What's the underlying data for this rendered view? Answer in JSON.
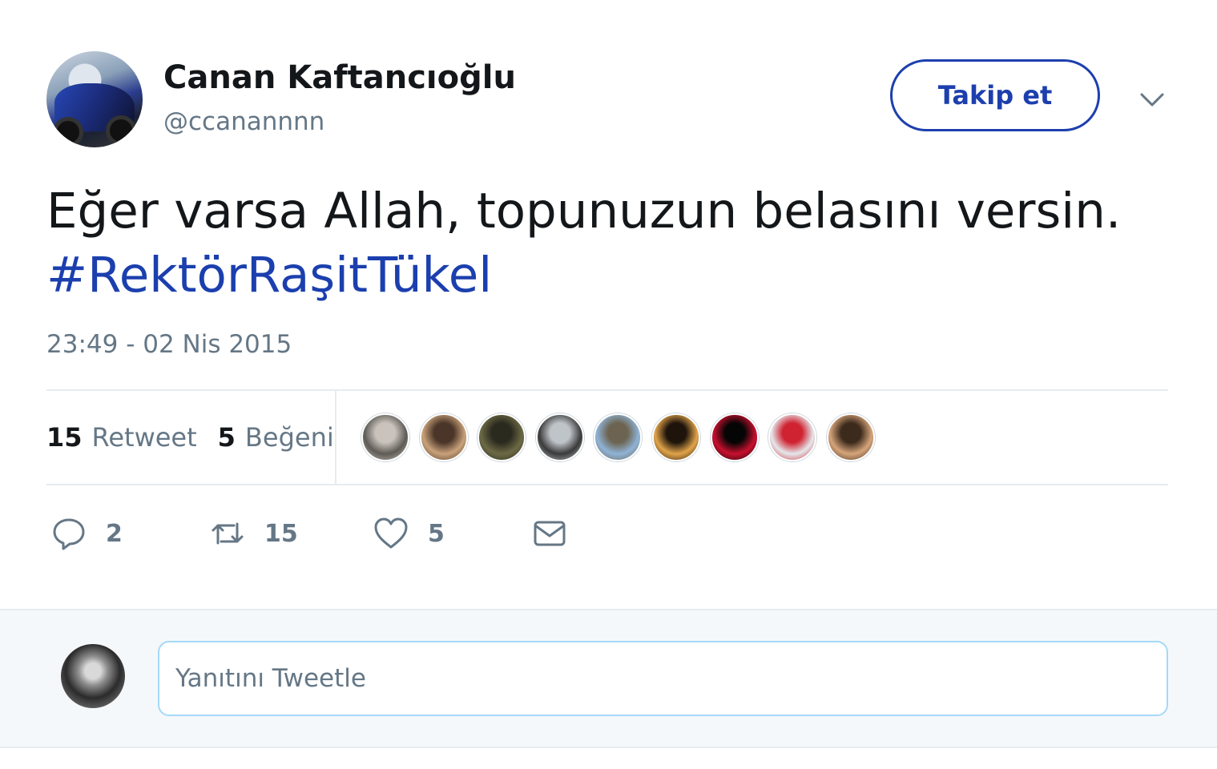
{
  "author": {
    "name": "Canan Kaftancıoğlu",
    "handle": "@ccanannnn"
  },
  "follow_label": "Takip et",
  "tweet": {
    "text": "Eğer varsa Allah, topunuzun belasını versin.",
    "hashtag": "#RektörRaşitTükel",
    "timestamp": "23:49 - 02 Nis 2015"
  },
  "stats": {
    "retweet_count": "15",
    "retweet_label": "Retweet",
    "like_count": "5",
    "like_label": "Beğeni"
  },
  "likers": [
    {
      "color_a": "#5e5a55",
      "color_b": "#c9c3bc"
    },
    {
      "color_a": "#c9a27a",
      "color_b": "#4a3528"
    },
    {
      "color_a": "#6c6a45",
      "color_b": "#2b2a1f"
    },
    {
      "color_a": "#3a3a3a",
      "color_b": "#bfc4c9"
    },
    {
      "color_a": "#8fb3d6",
      "color_b": "#6c6450"
    },
    {
      "color_a": "#e1a44a",
      "color_b": "#1e140b"
    },
    {
      "color_a": "#c8102e",
      "color_b": "#050505"
    },
    {
      "color_a": "#e4e8ec",
      "color_b": "#d02331"
    },
    {
      "color_a": "#d6a57a",
      "color_b": "#3c2a1c"
    }
  ],
  "actions": {
    "reply_count": "2",
    "retweet_count": "15",
    "like_count": "5"
  },
  "reply": {
    "placeholder": "Yanıtını Tweetle"
  },
  "colors": {
    "accent": "#1d3fae",
    "secondary_text": "#657786",
    "border": "#e6ecf0",
    "reply_bg": "#f5f8fa"
  },
  "icons": [
    "chevron-down-icon",
    "reply-icon",
    "retweet-icon",
    "heart-icon",
    "envelope-icon"
  ]
}
